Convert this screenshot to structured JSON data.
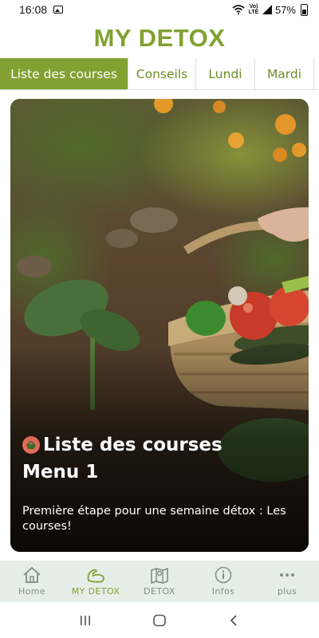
{
  "status_bar": {
    "time": "16:08",
    "network": "Vo) LTE",
    "battery": "57%"
  },
  "app": {
    "title": "MY DETOX"
  },
  "tabs": [
    {
      "label": "Liste des courses",
      "active": true
    },
    {
      "label": "Conseils",
      "active": false
    },
    {
      "label": "Lundi",
      "active": false
    },
    {
      "label": "Mardi",
      "active": false
    }
  ],
  "card": {
    "title": "Liste des courses",
    "subtitle": "Menu 1",
    "description": "Première étape pour une semaine détox : Les courses!",
    "icon": "basket-icon"
  },
  "bottom_nav": [
    {
      "label": "Home",
      "icon": "home-icon",
      "active": false
    },
    {
      "label": "MY DETOX",
      "icon": "detox-bicep-icon",
      "active": true
    },
    {
      "label": "DETOX",
      "icon": "map-icon",
      "active": false
    },
    {
      "label": "Infos",
      "icon": "info-icon",
      "active": false
    },
    {
      "label": "plus",
      "icon": "more-icon",
      "active": false
    }
  ],
  "colors": {
    "accent": "#82a132",
    "nav_background": "#e6eee8",
    "nav_inactive": "#7f8f86"
  }
}
